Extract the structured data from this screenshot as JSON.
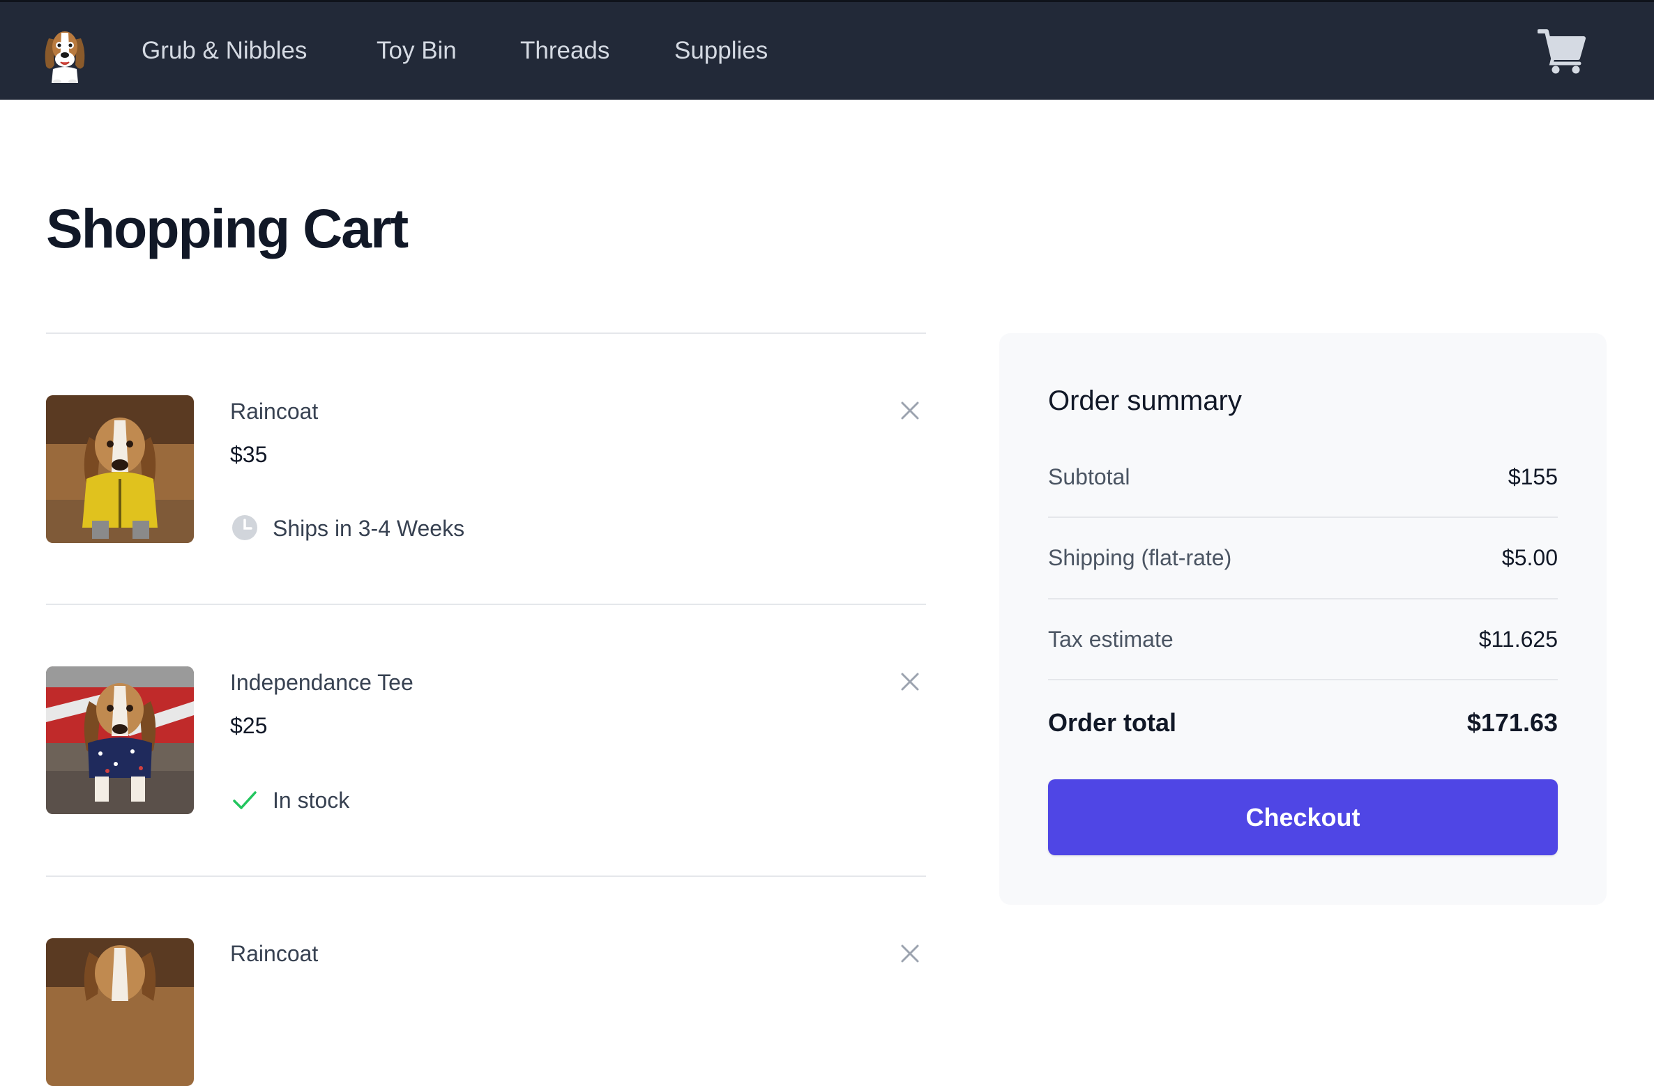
{
  "nav": {
    "logo_icon": "beagle-logo-icon",
    "links": [
      "Grub & Nibbles",
      "Toy Bin",
      "Threads",
      "Supplies"
    ],
    "cart_icon": "shopping-cart-icon"
  },
  "page": {
    "title": "Shopping Cart"
  },
  "cart": {
    "items": [
      {
        "name": "Raincoat",
        "price": "$35",
        "status": "Ships in 3-4 Weeks",
        "status_icon": "clock-icon",
        "image": "beagle-yellow-raincoat-photo"
      },
      {
        "name": "Independance Tee",
        "price": "$25",
        "status": "In stock",
        "status_icon": "check-icon",
        "image": "beagle-star-tee-photo"
      },
      {
        "name": "Raincoat",
        "image": "beagle-yellow-raincoat-photo"
      }
    ],
    "remove_icon": "close-icon"
  },
  "summary": {
    "title": "Order summary",
    "rows": [
      {
        "label": "Subtotal",
        "value": "$155"
      },
      {
        "label": "Shipping (flat-rate)",
        "value": "$5.00"
      },
      {
        "label": "Tax estimate",
        "value": "$11.625"
      }
    ],
    "total_label": "Order total",
    "total_value": "$171.63",
    "checkout_label": "Checkout"
  },
  "colors": {
    "nav_bg": "#222938",
    "accent": "#4f46e5",
    "in_stock": "#22c55e",
    "summary_bg": "#f8f9fb"
  }
}
